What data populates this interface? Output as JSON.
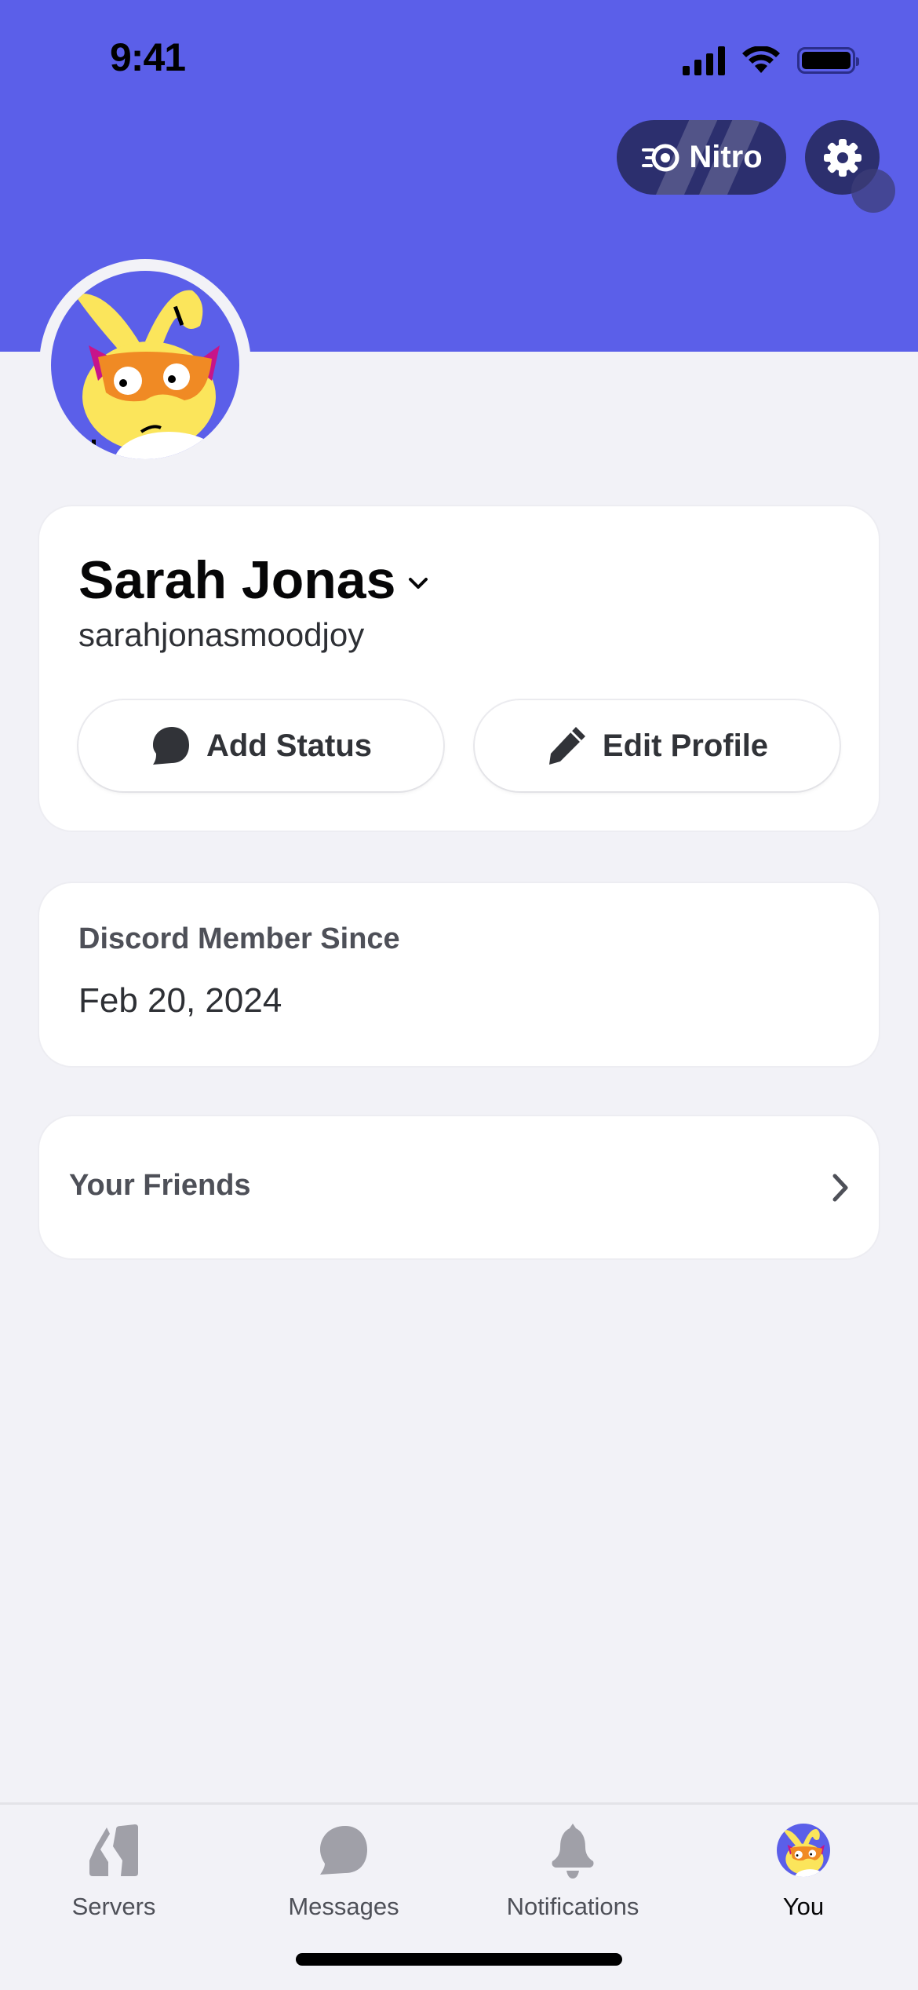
{
  "status_bar": {
    "time": "9:41"
  },
  "header": {
    "nitro_label": "Nitro",
    "colors": {
      "banner": "#5B5FE9",
      "button_bg": "#2C2F6E"
    }
  },
  "profile": {
    "display_name": "Sarah Jonas",
    "username": "sarahjonasmoodjoy",
    "add_status_label": "Add Status",
    "edit_profile_label": "Edit Profile"
  },
  "member_since": {
    "label": "Discord Member Since",
    "date": "Feb 20, 2024"
  },
  "friends": {
    "label": "Your Friends"
  },
  "tabbar": {
    "items": [
      {
        "label": "Servers",
        "icon": "servers-icon"
      },
      {
        "label": "Messages",
        "icon": "messages-icon"
      },
      {
        "label": "Notifications",
        "icon": "bell-icon"
      },
      {
        "label": "You",
        "icon": "avatar",
        "active": true
      }
    ]
  }
}
